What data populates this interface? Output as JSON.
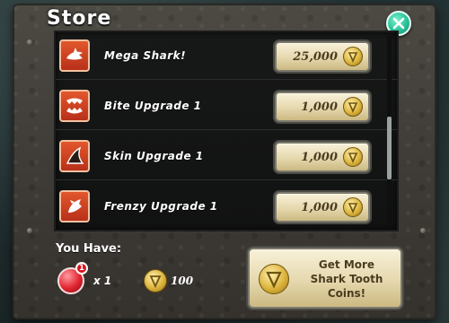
{
  "store": {
    "title": "Store",
    "items": [
      {
        "name": "Mega Shark!",
        "price": "25,000"
      },
      {
        "name": "Bite Upgrade 1",
        "price": "1,000"
      },
      {
        "name": "Skin Upgrade 1",
        "price": "1,000"
      },
      {
        "name": "Frenzy Upgrade 1",
        "price": "1,000"
      }
    ]
  },
  "wallet": {
    "label": "You Have:",
    "gem_badge": "1",
    "gem_count": "x 1",
    "coin_count": "100"
  },
  "get_more": {
    "line1": "Get More",
    "line2": "Shark Tooth",
    "line3": "Coins!"
  },
  "colors": {
    "close_button": "#28c198",
    "item_icon": "#e2572c",
    "price_button": "#e6d8ae"
  },
  "icons": [
    "close-icon",
    "shark-icon",
    "jaws-icon",
    "fin-icon",
    "frenzy-shark-icon",
    "shark-tooth-coin-icon",
    "red-gem-icon"
  ]
}
